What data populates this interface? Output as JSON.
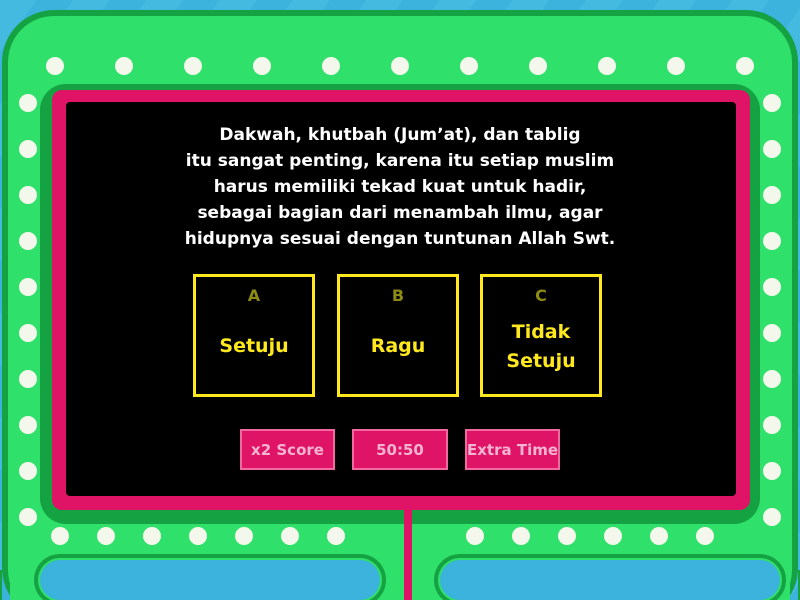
{
  "colors": {
    "background": "#3bb3dc",
    "frame_green": "#2fe06a",
    "frame_dark_green": "#15a242",
    "frame_pink": "#df1467",
    "screen": "#000000",
    "answer_border": "#ffe81e",
    "answer_letter": "#8d8a16",
    "question_text": "#ffffff",
    "powerup_bg": "#df1467",
    "powerup_text": "#f4b4d0",
    "bulb": "#f4f7ec"
  },
  "question": {
    "text": "Dakwah, khutbah (Jumʼat), dan tablig\nitu sangat penting, karena itu setiap muslim\nharus memiliki tekad kuat untuk hadir,\nsebagai bagian dari menambah ilmu, agar\nhidupnya sesuai dengan tuntunan Allah Swt."
  },
  "answers": [
    {
      "letter": "A",
      "text": "Setuju"
    },
    {
      "letter": "B",
      "text": "Ragu"
    },
    {
      "letter": "C",
      "text": "Tidak\nSetuju"
    }
  ],
  "powerups": [
    {
      "label": "x2 Score"
    },
    {
      "label": "50:50"
    },
    {
      "label": "Extra Time"
    }
  ]
}
